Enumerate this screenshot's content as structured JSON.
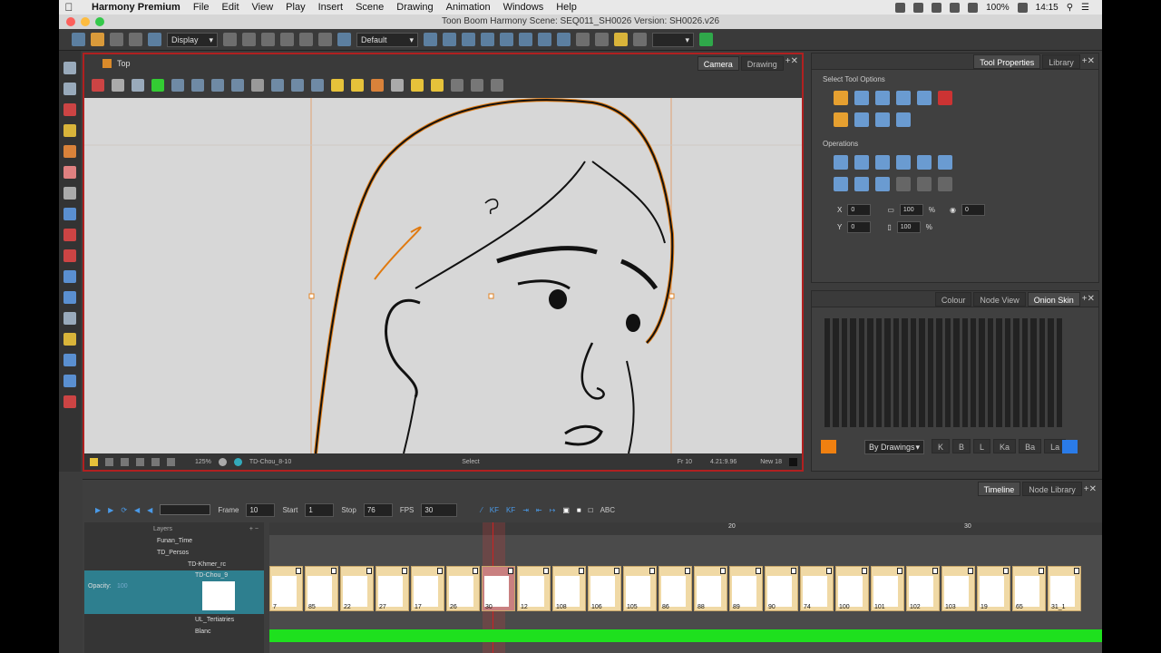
{
  "menubar": {
    "app": "Harmony Premium",
    "items": [
      "File",
      "Edit",
      "View",
      "Play",
      "Insert",
      "Scene",
      "Drawing",
      "Animation",
      "Windows",
      "Help"
    ],
    "battery": "100%",
    "time": "14:15"
  },
  "window": {
    "title": "Toon Boom Harmony Scene: SEQ011_SH0026 Version: SH0026.v26"
  },
  "toolbar": {
    "display_combo": "Display",
    "view_combo": "Default"
  },
  "camera": {
    "title": "Top",
    "tabs": [
      "Camera",
      "Drawing"
    ],
    "status": {
      "zoom": "125%",
      "drawing": "TD-Chou_8-10",
      "tool": "Select",
      "frame": "Fr 10",
      "coords": "4.21:9.96",
      "new": "New 18"
    }
  },
  "tool_properties": {
    "tabs": [
      "Tool Properties",
      "Library"
    ],
    "select_label": "Select Tool Options",
    "operations_label": "Operations",
    "fields": {
      "x": "0",
      "y": "0",
      "w": "100",
      "h": "100",
      "angle": "0",
      "pct": "%"
    }
  },
  "onion": {
    "tabs": [
      "Colour",
      "Node View",
      "Onion Skin"
    ],
    "mode": "By Drawings",
    "buttons": [
      "K",
      "B",
      "L",
      "Ka",
      "Ba",
      "La"
    ]
  },
  "timeline": {
    "tabs": [
      "Timeline",
      "Node Library"
    ],
    "frame_label": "Frame",
    "frame": "10",
    "start_label": "Start",
    "start": "1",
    "stop_label": "Stop",
    "stop": "76",
    "fps_label": "FPS",
    "fps": "30",
    "ruler": [
      "10",
      "20",
      "30"
    ],
    "layers_header": "Layers",
    "layers": [
      "Funan_Time",
      "TD_Persos",
      "TD-Khmer_rc",
      "TD-Chou_9",
      "UL_Tertiatries",
      "Blanc"
    ],
    "opacity_label": "Opacity:",
    "opacity": "100",
    "thumbs": [
      "7",
      "85",
      "22",
      "27",
      "17",
      "26",
      "30",
      "12",
      "108",
      "106",
      "105",
      "86",
      "88",
      "89",
      "90",
      "74",
      "100",
      "101",
      "102",
      "103",
      "19",
      "65",
      "31_1"
    ]
  }
}
